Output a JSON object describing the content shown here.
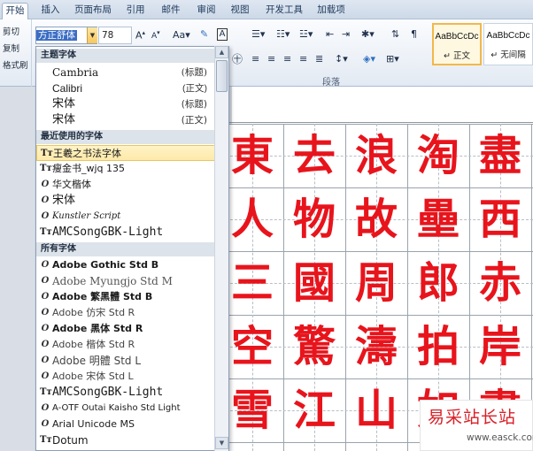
{
  "ribbon_tabs": [
    "开始",
    "插入",
    "页面布局",
    "引用",
    "邮件",
    "审阅",
    "视图",
    "开发工具",
    "加载项"
  ],
  "clipboard": {
    "cut": "剪切",
    "copy": "复制",
    "format_painter": "格式刷"
  },
  "font_name": "方正舒体",
  "font_size": "78",
  "styles": [
    {
      "sample": "AaBbCcDc",
      "name": "↵ 正文"
    },
    {
      "sample": "AaBbCcDc",
      "name": "↵ 无间隔"
    }
  ],
  "group_paragraph": "段落",
  "dropdown": {
    "theme_header": "主题字体",
    "theme_fonts": [
      {
        "name": "Cambria",
        "tag": "(标题)"
      },
      {
        "name": "Calibri",
        "tag": "(正文)"
      },
      {
        "name": "宋体",
        "tag": "(标题)"
      },
      {
        "name": "宋体",
        "tag": "(正文)"
      }
    ],
    "recent_header": "最近使用的字体",
    "recent_fonts": [
      {
        "name": "王羲之书法字体",
        "icon": "truetype-icon"
      },
      {
        "name": "瘦金书_wjq 135",
        "icon": "truetype-icon"
      },
      {
        "name": "华文楷体",
        "icon": "opentype-icon"
      },
      {
        "name": "宋体",
        "icon": "opentype-icon"
      },
      {
        "name": "Kunstler Script",
        "icon": "opentype-icon"
      },
      {
        "name": "AMCSongGBK-Light",
        "icon": "truetype-icon"
      }
    ],
    "all_header": "所有字体",
    "all_fonts": [
      {
        "name": "Adobe Gothic Std B",
        "icon": "opentype-icon"
      },
      {
        "name": "Adobe Myungjo Std M",
        "icon": "opentype-icon"
      },
      {
        "name": "Adobe 繁黑體 Std B",
        "icon": "opentype-icon"
      },
      {
        "name": "Adobe 仿宋 Std R",
        "icon": "opentype-icon"
      },
      {
        "name": "Adobe 黑体 Std R",
        "icon": "opentype-icon"
      },
      {
        "name": "Adobe 楷体 Std R",
        "icon": "opentype-icon"
      },
      {
        "name": "Adobe 明體 Std L",
        "icon": "opentype-icon"
      },
      {
        "name": "Adobe 宋体 Std L",
        "icon": "opentype-icon"
      },
      {
        "name": "AMCSongGBK-Light",
        "icon": "truetype-icon"
      },
      {
        "name": "A-OTF Outai Kaisho Std Light",
        "icon": "opentype-icon"
      },
      {
        "name": "Arial Unicode MS",
        "icon": "opentype-icon"
      },
      {
        "name": "Dotum",
        "icon": "truetype-icon"
      }
    ]
  },
  "document_characters": [
    [
      "東",
      "去",
      "浪",
      "淘",
      "盡"
    ],
    [
      "人",
      "物",
      "故",
      "壘",
      "西"
    ],
    [
      "三",
      "國",
      "周",
      "郎",
      "赤"
    ],
    [
      "空",
      "驚",
      "濤",
      "拍",
      "岸"
    ],
    [
      "雪",
      "江",
      "山",
      "如",
      "畫"
    ]
  ],
  "watermark": {
    "title": "易采站长站",
    "url": "www.easck.com"
  },
  "colors": {
    "calligraphy_red": "#e8141c",
    "ribbon_blue": "#1e395b",
    "highlight": "#fde9a8"
  }
}
